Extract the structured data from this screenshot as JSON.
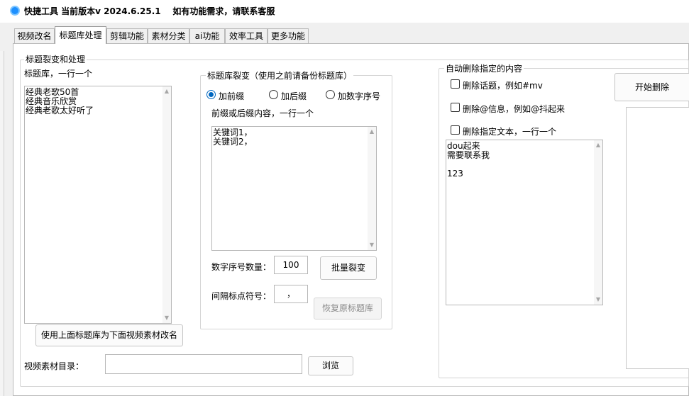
{
  "window": {
    "title": "快捷工具 当前版本v 2024.6.25.1    如有功能需求，请联系客服"
  },
  "tabs": [
    "视频改名",
    "标题库处理",
    "剪辑功能",
    "素材分类",
    "ai功能",
    "效率工具",
    "更多功能"
  ],
  "active_tab": "标题库处理",
  "split_group": {
    "legend": "标题裂变和处理",
    "library_label": "标题库，一行一个",
    "library_text": "经典老歌50首\n经典音乐欣赏\n经典老歌太好听了",
    "rename_button": "使用上面标题库为下面视频素材改名",
    "video_dir_label": "视频素材目录：",
    "video_dir_value": "",
    "browse_button": "浏览"
  },
  "fission_group": {
    "legend": "标题库裂变（使用之前请备份标题库）",
    "radios": [
      "加前缀",
      "加后缀",
      "加数字序号"
    ],
    "selected": "加前缀",
    "content_label": "前缀或后缀内容，一行一个",
    "content_text": "关键词1，\n关键词2，",
    "number_label": "数字序号数量：",
    "number_value": "100",
    "separator_label": "间隔标点符号：",
    "separator_value": "，",
    "batch_button": "批量裂变",
    "restore_button": "恢复原标题库"
  },
  "auto_delete_group": {
    "legend": "自动删除指定的内容",
    "checkboxes": [
      "删除话题，例如#mv",
      "删除@信息，例如@抖起来",
      "删除指定文本，一行一个"
    ],
    "text": "dou起来\n需要联系我\n\n123",
    "start_button": "开始删除"
  }
}
